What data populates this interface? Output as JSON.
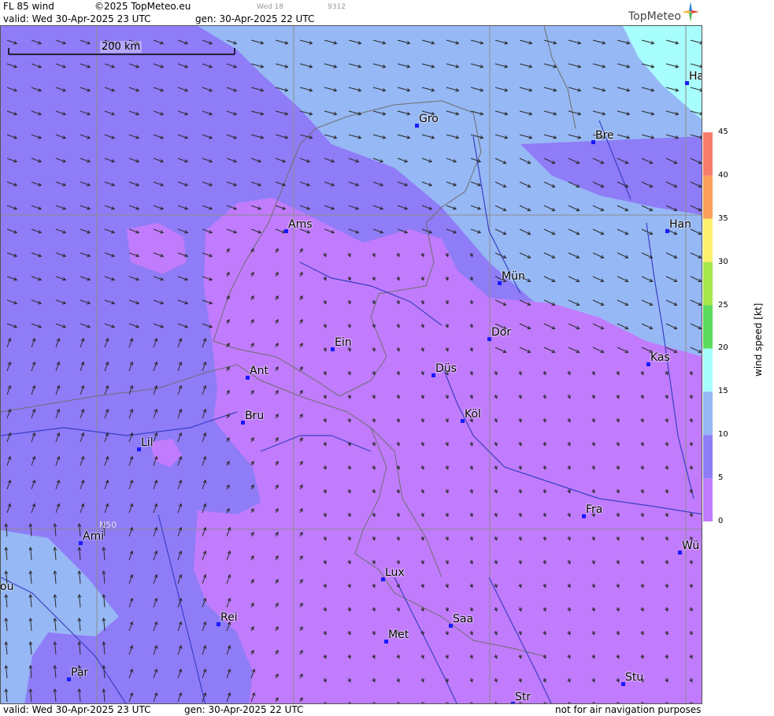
{
  "header": {
    "product": "FL 85 wind",
    "copyright": "©2025 TopMeteo.eu",
    "valid": "valid:  Wed  30-Apr-2025  23 UTC",
    "generated": "gen: 30-Apr-2025 22 UTC",
    "small_day": "Wed 18",
    "small_code": "9312",
    "logo_text": "TopMeteo"
  },
  "footer": {
    "valid": "valid:  Wed  30-Apr-2025  23 UTC",
    "generated": "gen: 30-Apr-2025 22 UTC",
    "disclaimer": "not for air navigation purposes"
  },
  "map": {
    "scale_label": "200 km",
    "latitude_label": "N50",
    "colors": {
      "calm_violet": "#c07cfc",
      "low_blue_violet": "#8f7cf7",
      "medium_blue": "#96b8f5",
      "high_cyan": "#a8fdfd",
      "grid": "#8c8c8c",
      "river": "#3b40c4",
      "border": "#6e6e6e",
      "city_marker": "#1a1aff"
    },
    "cities": [
      {
        "name": "Gro"
      },
      {
        "name": "Bre"
      },
      {
        "name": "Ha"
      },
      {
        "name": "Ams"
      },
      {
        "name": "Han"
      },
      {
        "name": "Mün"
      },
      {
        "name": "Dor"
      },
      {
        "name": "Ein"
      },
      {
        "name": "Kas"
      },
      {
        "name": "Ant"
      },
      {
        "name": "Düs"
      },
      {
        "name": "Köl"
      },
      {
        "name": "Bru"
      },
      {
        "name": "Lil"
      },
      {
        "name": "Fra"
      },
      {
        "name": "Ami"
      },
      {
        "name": "Wü"
      },
      {
        "name": "Lux"
      },
      {
        "name": "ou"
      },
      {
        "name": "Rei"
      },
      {
        "name": "Saa"
      },
      {
        "name": "Met"
      },
      {
        "name": "Stu"
      },
      {
        "name": "Par"
      },
      {
        "name": "Str"
      }
    ]
  },
  "legend": {
    "title": "wind speed [kt]",
    "ticks": [
      "45",
      "40",
      "35",
      "30",
      "25",
      "20",
      "15",
      "10",
      "5",
      "0"
    ],
    "bands": [
      {
        "from": 40,
        "to": 45,
        "color": "#f87c6c"
      },
      {
        "from": 35,
        "to": 40,
        "color": "#fca05c"
      },
      {
        "from": 30,
        "to": 35,
        "color": "#fcf06c"
      },
      {
        "from": 25,
        "to": 30,
        "color": "#a8e84c"
      },
      {
        "from": 20,
        "to": 25,
        "color": "#5cdc5c"
      },
      {
        "from": 15,
        "to": 20,
        "color": "#a8fdfd"
      },
      {
        "from": 10,
        "to": 15,
        "color": "#96b8f5"
      },
      {
        "from": 5,
        "to": 10,
        "color": "#8f7cf7"
      },
      {
        "from": 0,
        "to": 5,
        "color": "#c07cfc"
      }
    ]
  }
}
